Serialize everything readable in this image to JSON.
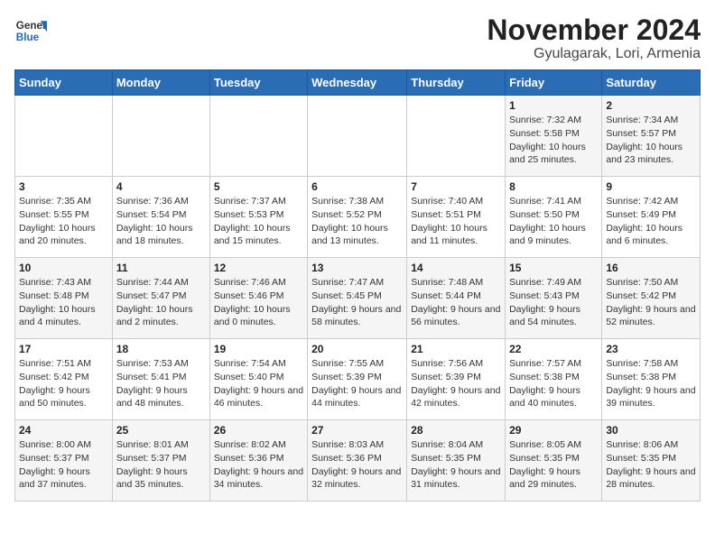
{
  "header": {
    "logo_general": "General",
    "logo_blue": "Blue",
    "title": "November 2024",
    "subtitle": "Gyulagarak, Lori, Armenia"
  },
  "weekdays": [
    "Sunday",
    "Monday",
    "Tuesday",
    "Wednesday",
    "Thursday",
    "Friday",
    "Saturday"
  ],
  "weeks": [
    [
      {
        "day": "",
        "info": ""
      },
      {
        "day": "",
        "info": ""
      },
      {
        "day": "",
        "info": ""
      },
      {
        "day": "",
        "info": ""
      },
      {
        "day": "",
        "info": ""
      },
      {
        "day": "1",
        "info": "Sunrise: 7:32 AM\nSunset: 5:58 PM\nDaylight: 10 hours and 25 minutes."
      },
      {
        "day": "2",
        "info": "Sunrise: 7:34 AM\nSunset: 5:57 PM\nDaylight: 10 hours and 23 minutes."
      }
    ],
    [
      {
        "day": "3",
        "info": "Sunrise: 7:35 AM\nSunset: 5:55 PM\nDaylight: 10 hours and 20 minutes."
      },
      {
        "day": "4",
        "info": "Sunrise: 7:36 AM\nSunset: 5:54 PM\nDaylight: 10 hours and 18 minutes."
      },
      {
        "day": "5",
        "info": "Sunrise: 7:37 AM\nSunset: 5:53 PM\nDaylight: 10 hours and 15 minutes."
      },
      {
        "day": "6",
        "info": "Sunrise: 7:38 AM\nSunset: 5:52 PM\nDaylight: 10 hours and 13 minutes."
      },
      {
        "day": "7",
        "info": "Sunrise: 7:40 AM\nSunset: 5:51 PM\nDaylight: 10 hours and 11 minutes."
      },
      {
        "day": "8",
        "info": "Sunrise: 7:41 AM\nSunset: 5:50 PM\nDaylight: 10 hours and 9 minutes."
      },
      {
        "day": "9",
        "info": "Sunrise: 7:42 AM\nSunset: 5:49 PM\nDaylight: 10 hours and 6 minutes."
      }
    ],
    [
      {
        "day": "10",
        "info": "Sunrise: 7:43 AM\nSunset: 5:48 PM\nDaylight: 10 hours and 4 minutes."
      },
      {
        "day": "11",
        "info": "Sunrise: 7:44 AM\nSunset: 5:47 PM\nDaylight: 10 hours and 2 minutes."
      },
      {
        "day": "12",
        "info": "Sunrise: 7:46 AM\nSunset: 5:46 PM\nDaylight: 10 hours and 0 minutes."
      },
      {
        "day": "13",
        "info": "Sunrise: 7:47 AM\nSunset: 5:45 PM\nDaylight: 9 hours and 58 minutes."
      },
      {
        "day": "14",
        "info": "Sunrise: 7:48 AM\nSunset: 5:44 PM\nDaylight: 9 hours and 56 minutes."
      },
      {
        "day": "15",
        "info": "Sunrise: 7:49 AM\nSunset: 5:43 PM\nDaylight: 9 hours and 54 minutes."
      },
      {
        "day": "16",
        "info": "Sunrise: 7:50 AM\nSunset: 5:42 PM\nDaylight: 9 hours and 52 minutes."
      }
    ],
    [
      {
        "day": "17",
        "info": "Sunrise: 7:51 AM\nSunset: 5:42 PM\nDaylight: 9 hours and 50 minutes."
      },
      {
        "day": "18",
        "info": "Sunrise: 7:53 AM\nSunset: 5:41 PM\nDaylight: 9 hours and 48 minutes."
      },
      {
        "day": "19",
        "info": "Sunrise: 7:54 AM\nSunset: 5:40 PM\nDaylight: 9 hours and 46 minutes."
      },
      {
        "day": "20",
        "info": "Sunrise: 7:55 AM\nSunset: 5:39 PM\nDaylight: 9 hours and 44 minutes."
      },
      {
        "day": "21",
        "info": "Sunrise: 7:56 AM\nSunset: 5:39 PM\nDaylight: 9 hours and 42 minutes."
      },
      {
        "day": "22",
        "info": "Sunrise: 7:57 AM\nSunset: 5:38 PM\nDaylight: 9 hours and 40 minutes."
      },
      {
        "day": "23",
        "info": "Sunrise: 7:58 AM\nSunset: 5:38 PM\nDaylight: 9 hours and 39 minutes."
      }
    ],
    [
      {
        "day": "24",
        "info": "Sunrise: 8:00 AM\nSunset: 5:37 PM\nDaylight: 9 hours and 37 minutes."
      },
      {
        "day": "25",
        "info": "Sunrise: 8:01 AM\nSunset: 5:37 PM\nDaylight: 9 hours and 35 minutes."
      },
      {
        "day": "26",
        "info": "Sunrise: 8:02 AM\nSunset: 5:36 PM\nDaylight: 9 hours and 34 minutes."
      },
      {
        "day": "27",
        "info": "Sunrise: 8:03 AM\nSunset: 5:36 PM\nDaylight: 9 hours and 32 minutes."
      },
      {
        "day": "28",
        "info": "Sunrise: 8:04 AM\nSunset: 5:35 PM\nDaylight: 9 hours and 31 minutes."
      },
      {
        "day": "29",
        "info": "Sunrise: 8:05 AM\nSunset: 5:35 PM\nDaylight: 9 hours and 29 minutes."
      },
      {
        "day": "30",
        "info": "Sunrise: 8:06 AM\nSunset: 5:35 PM\nDaylight: 9 hours and 28 minutes."
      }
    ]
  ]
}
